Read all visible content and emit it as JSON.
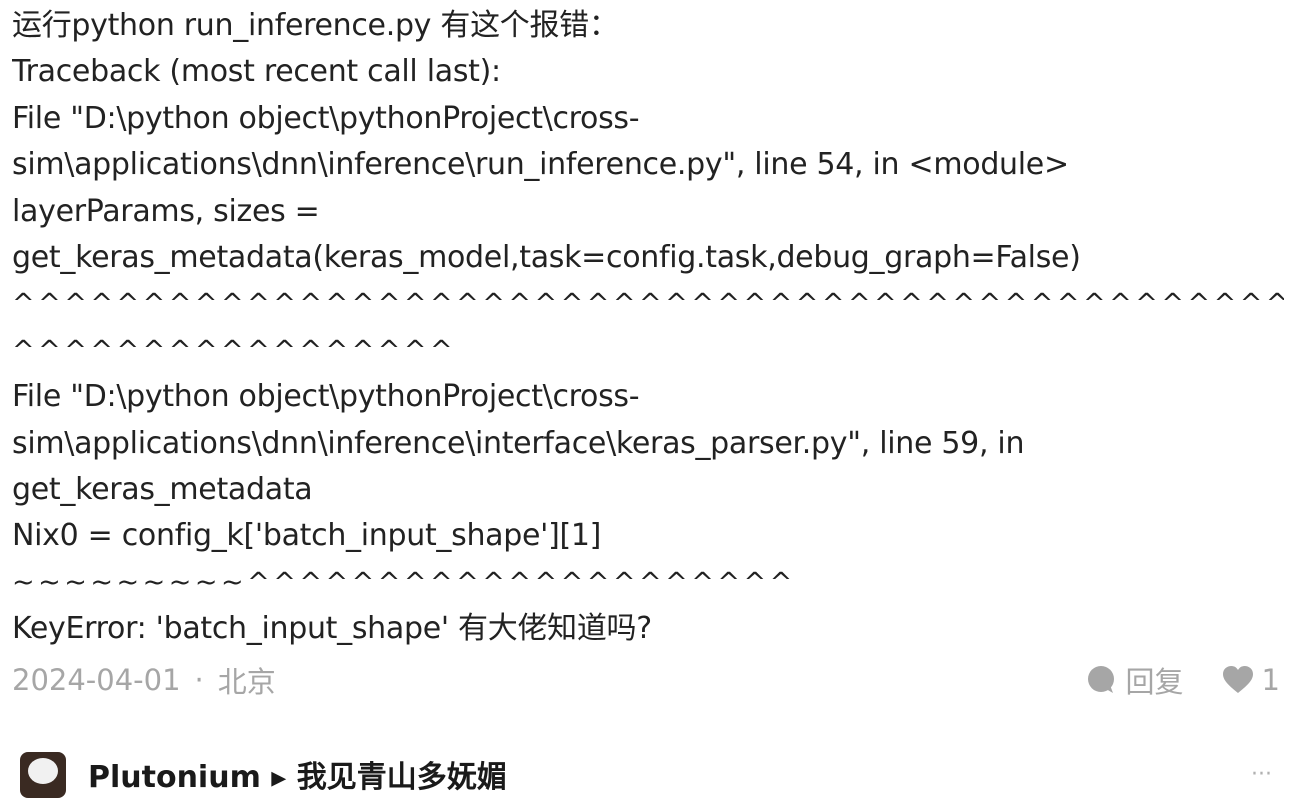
{
  "comment": {
    "lines": [
      "运行python run_inference.py 有这个报错：",
      "Traceback (most recent call last):",
      "File \"D:\\python object\\pythonProject\\cross-",
      "sim\\applications\\dnn\\inference\\run_inference.py\", line 54, in <module>",
      "layerParams, sizes =",
      "get_keras_metadata(keras_model,task=config.task,debug_graph=False)",
      "^^^^^^^^^^^^^^^^^^^^^^^^^^^^^^^^^^^^^^^^^^^^^^^^^^^^^",
      "^^^^^^^^^^^^^^^^^",
      "File \"D:\\python object\\pythonProject\\cross-",
      "sim\\applications\\dnn\\inference\\interface\\keras_parser.py\", line 59, in",
      "get_keras_metadata",
      "Nix0 = config_k['batch_input_shape'][1]",
      "~~~~~~~~~^^^^^^^^^^^^^^^^^^^^^",
      "KeyError: 'batch_input_shape' 有大佬知道吗?"
    ],
    "date": "2024-04-01",
    "separator": "·",
    "location": "北京",
    "reply_label": "回复",
    "like_count": "1"
  },
  "next_comment": {
    "author": "Plutonium ▸ 我见青山多妩媚",
    "more": "···"
  },
  "colors": {
    "text": "#222222",
    "meta": "#a6a6a6",
    "icon": "#a6a6a6"
  },
  "icons": {
    "reply": "speech-bubble-icon",
    "like": "heart-icon"
  }
}
